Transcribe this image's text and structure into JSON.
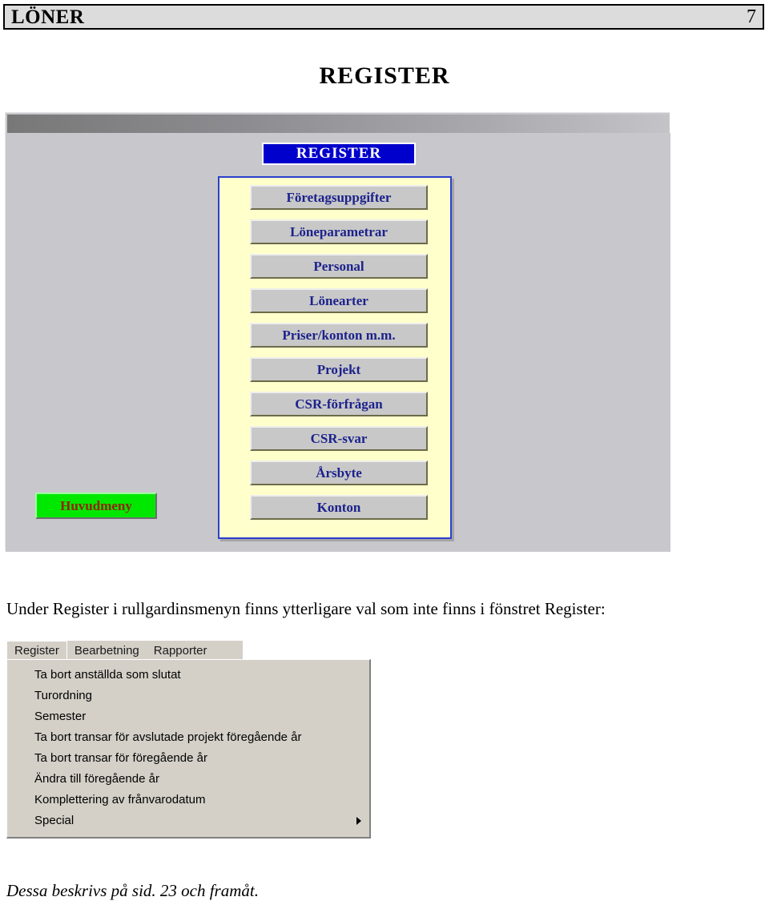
{
  "page_header": {
    "title": "LÖNER",
    "page_number": "7"
  },
  "document": {
    "title": "REGISTER",
    "body_paragraph": "Under Register i rullgardinsmenyn finns ytterligare val som inte finns i fönstret Register:",
    "footer_note": "Dessa beskrivs på sid. 23 och framåt."
  },
  "app_window": {
    "heading": "REGISTER",
    "buttons": [
      {
        "label": "Företagsuppgifter"
      },
      {
        "label": "Löneparametrar"
      },
      {
        "label": "Personal"
      },
      {
        "label": "Lönearter"
      },
      {
        "label": "Priser/konton m.m."
      },
      {
        "label": "Projekt"
      },
      {
        "label": "CSR-förfrågan"
      },
      {
        "label": "CSR-svar"
      },
      {
        "label": "Årsbyte"
      },
      {
        "label": "Konton"
      }
    ],
    "main_menu_button": "Huvudmeny"
  },
  "dropdown_screenshot": {
    "menubar": [
      {
        "label": "Register",
        "active": true
      },
      {
        "label": "Bearbetning",
        "active": false
      },
      {
        "label": "Rapporter",
        "active": false
      }
    ],
    "items": [
      {
        "label": "Ta bort anställda som slutat",
        "submenu": false
      },
      {
        "label": "Turordning",
        "submenu": false
      },
      {
        "label": "Semester",
        "submenu": false
      },
      {
        "label": "Ta bort transar för avslutade projekt föregående år",
        "submenu": false
      },
      {
        "label": "Ta bort transar för föregående år",
        "submenu": false
      },
      {
        "label": "Ändra till föregående år",
        "submenu": false
      },
      {
        "label": "Komplettering av frånvarodatum",
        "submenu": false
      },
      {
        "label": "Special",
        "submenu": true
      }
    ]
  },
  "colors": {
    "header_bg": "#dcdcdc",
    "register_blue": "#0000cc",
    "panel_yellow": "#ffffcc",
    "panel_border_blue": "#2b3fd0",
    "button_face": "#c8c8c8",
    "button_text": "#1c228c",
    "huvudmeny_green": "#00e800",
    "huvudmeny_text": "#96230a",
    "window_face": "#c8c8cc",
    "menu_face": "#d4d0c8"
  }
}
